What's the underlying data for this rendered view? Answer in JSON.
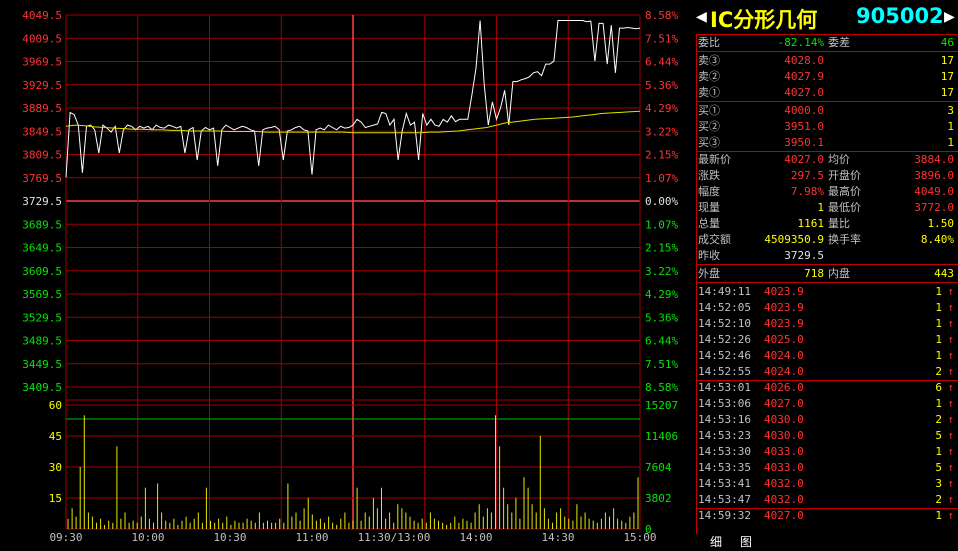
{
  "chart_data": [
    {
      "type": "line",
      "title": "",
      "x_range": [
        "09:30",
        "15:00"
      ],
      "y_ticks_price": [
        "4049.5",
        "4009.5",
        "3969.5",
        "3929.5",
        "3889.5",
        "3849.5",
        "3809.5",
        "3769.5",
        "3729.5",
        "3689.5",
        "3649.5",
        "3609.5",
        "3569.5",
        "3529.5",
        "3489.5",
        "3449.5",
        "3409.5"
      ],
      "y_ticks_pct": [
        "8.58%",
        "7.51%",
        "6.44%",
        "5.36%",
        "4.29%",
        "3.22%",
        "2.15%",
        "1.07%",
        "0.00%",
        "1.07%",
        "2.15%",
        "3.22%",
        "4.29%",
        "5.36%",
        "6.44%",
        "7.51%",
        "8.58%"
      ],
      "ylim": [
        3409.5,
        4049.5
      ],
      "prev_close": 3729.5,
      "series": [
        {
          "color": "#ffffff",
          "values": [
            3770,
            3882,
            3878,
            3860,
            3778,
            3858,
            3860,
            3852,
            3812,
            3860,
            3855,
            3848,
            3858,
            3812,
            3852,
            3860,
            3858,
            3852,
            3858,
            3855,
            3858,
            3852,
            3860,
            3856,
            3855,
            3860,
            3858,
            3855,
            3858,
            3812,
            3852,
            3856,
            3800,
            3850,
            3856,
            3852,
            3855,
            3790,
            3852,
            3860,
            3856,
            3852,
            3855,
            3858,
            3856,
            3852,
            3850,
            3790,
            3852,
            3855,
            3856,
            3858,
            3852,
            3800,
            3850,
            3852,
            3856,
            3858,
            3852,
            3850,
            3775,
            3852,
            3855,
            3852,
            3860,
            3856,
            3852,
            3858,
            3855,
            3856,
            3860,
            3870,
            3865,
            3856,
            3858,
            3860,
            3862,
            3882,
            3880,
            3860,
            3870,
            3800,
            3850,
            3880,
            3860,
            3865,
            3800,
            3880,
            3860,
            3870,
            3860,
            3858,
            3870,
            3865,
            3876,
            3866,
            3870,
            3870,
            3870,
            3912,
            3958,
            4040,
            3930,
            3860,
            3900,
            3870,
            3890,
            3920,
            3860,
            3935,
            3935,
            3938,
            3940,
            3943,
            3950,
            3952,
            3945,
            3965,
            3965,
            3970,
            4040,
            4040,
            4040,
            4040,
            4040,
            4040,
            4040,
            4038,
            4039,
            3970,
            4035,
            4035,
            3965,
            4032,
            3950,
            4027,
            4027,
            4028,
            4027,
            4026,
            4027
          ]
        },
        {
          "color": "#e0e000",
          "values": [
            3858,
            3860,
            3859,
            3857,
            3856,
            3855,
            3854,
            3853,
            3853,
            3852,
            3852,
            3851,
            3851,
            3850,
            3850,
            3850,
            3850,
            3849,
            3849,
            3849,
            3849,
            3848,
            3848,
            3848,
            3848,
            3848,
            3848,
            3848,
            3848,
            3848,
            3847,
            3847,
            3847,
            3847,
            3847,
            3847,
            3847,
            3847,
            3848,
            3848,
            3849,
            3850,
            3852,
            3854,
            3856,
            3860,
            3864,
            3866,
            3868,
            3870,
            3871,
            3872,
            3873,
            3874,
            3876,
            3878,
            3880,
            3881,
            3882,
            3883,
            3884
          ]
        }
      ]
    },
    {
      "type": "bar",
      "title": "",
      "ylim": [
        0,
        60
      ],
      "y_ticks_left": [
        "60",
        "45",
        "30",
        "15"
      ],
      "y_ticks_right": [
        "15207",
        "11406",
        "7604",
        "3802",
        "0"
      ],
      "values": [
        5,
        10,
        6,
        30,
        55,
        8,
        6,
        3,
        5,
        2,
        4,
        3,
        40,
        5,
        8,
        3,
        4,
        3,
        6,
        20,
        5,
        3,
        22,
        8,
        4,
        3,
        5,
        2,
        4,
        6,
        3,
        5,
        8,
        3,
        20,
        4,
        3,
        5,
        3,
        6,
        2,
        4,
        3,
        3,
        5,
        4,
        3,
        8,
        3,
        4,
        3,
        3,
        5,
        3,
        22,
        6,
        8,
        4,
        10,
        15,
        7,
        4,
        5,
        3,
        6,
        3,
        2,
        5,
        8,
        3,
        4,
        20,
        4,
        8,
        6,
        15,
        10,
        20,
        5,
        8,
        3,
        12,
        10,
        8,
        6,
        4,
        3,
        5,
        3,
        8,
        5,
        4,
        3,
        2,
        3,
        6,
        3,
        5,
        4,
        3,
        8,
        12,
        6,
        10,
        8,
        55,
        40,
        20,
        12,
        8,
        15,
        5,
        25,
        20,
        12,
        8,
        45,
        10,
        5,
        3,
        8,
        10,
        6,
        5,
        4,
        12,
        6,
        8,
        5,
        4,
        3,
        5,
        8,
        6,
        10,
        5,
        4,
        3,
        6,
        8,
        25
      ]
    }
  ],
  "time_labels": [
    "09:30",
    "10:00",
    "10:30",
    "11:00",
    "11:30/13:00",
    "14:00",
    "14:30",
    "15:00"
  ],
  "panel": {
    "title_name": "IC分形几何",
    "title_code": "905002",
    "arrow_left": "◀",
    "arrow_right": "▶",
    "wei_bi_label": "委比",
    "wei_bi": "-82.14%",
    "wei_cha_label": "委差",
    "wei_cha": "46",
    "sells": [
      {
        "label": "卖③",
        "price": "4028.0",
        "vol": "17"
      },
      {
        "label": "卖②",
        "price": "4027.9",
        "vol": "17"
      },
      {
        "label": "卖①",
        "price": "4027.0",
        "vol": "17"
      }
    ],
    "buys": [
      {
        "label": "买①",
        "price": "4000.0",
        "vol": "3"
      },
      {
        "label": "买②",
        "price": "3951.0",
        "vol": "1"
      },
      {
        "label": "买③",
        "price": "3950.1",
        "vol": "1"
      }
    ],
    "stats": [
      {
        "l1": "最新价",
        "v1": "4027.0",
        "l2": "均价",
        "v2": "3884.0"
      },
      {
        "l1": "涨跌",
        "v1": "297.5",
        "l2": "开盘价",
        "v2": "3896.0"
      },
      {
        "l1": "幅度",
        "v1": "7.98%",
        "l2": "最高价",
        "v2": "4049.0"
      },
      {
        "l1": "现量",
        "v1": "1",
        "l2": "最低价",
        "v2": "3772.0"
      },
      {
        "l1": "总量",
        "v1": "1161",
        "l2": "量比",
        "v2": "1.50"
      },
      {
        "l1": "成交额",
        "v1": "4509350.9",
        "l2": "换手率",
        "v2": "8.40%"
      }
    ],
    "zuo_shou_label": "昨收",
    "zuo_shou": "3729.5",
    "wai_pan_label": "外盘",
    "wai_pan": "718",
    "nei_pan_label": "内盘",
    "nei_pan": "443",
    "ticks": [
      {
        "t": "14:49:11",
        "p": "4023.9",
        "v": "1"
      },
      {
        "t": "14:52:05",
        "p": "4023.9",
        "v": "1"
      },
      {
        "t": "14:52:10",
        "p": "4023.9",
        "v": "1"
      },
      {
        "t": "14:52:26",
        "p": "4025.0",
        "v": "1"
      },
      {
        "t": "14:52:46",
        "p": "4024.0",
        "v": "1"
      },
      {
        "t": "14:52:55",
        "p": "4024.0",
        "v": "2"
      },
      {
        "t": "14:53:01",
        "p": "4026.0",
        "v": "6"
      },
      {
        "t": "14:53:06",
        "p": "4027.0",
        "v": "1"
      },
      {
        "t": "14:53:16",
        "p": "4030.0",
        "v": "2"
      },
      {
        "t": "14:53:23",
        "p": "4030.0",
        "v": "5"
      },
      {
        "t": "14:53:30",
        "p": "4033.0",
        "v": "1"
      },
      {
        "t": "14:53:35",
        "p": "4033.0",
        "v": "5"
      },
      {
        "t": "14:53:41",
        "p": "4032.0",
        "v": "3"
      },
      {
        "t": "14:53:47",
        "p": "4032.0",
        "v": "2"
      },
      {
        "t": "14:59:32",
        "p": "4027.0",
        "v": "1"
      }
    ],
    "up_arrow": "↑",
    "tab1": "细",
    "tab2": "图"
  }
}
